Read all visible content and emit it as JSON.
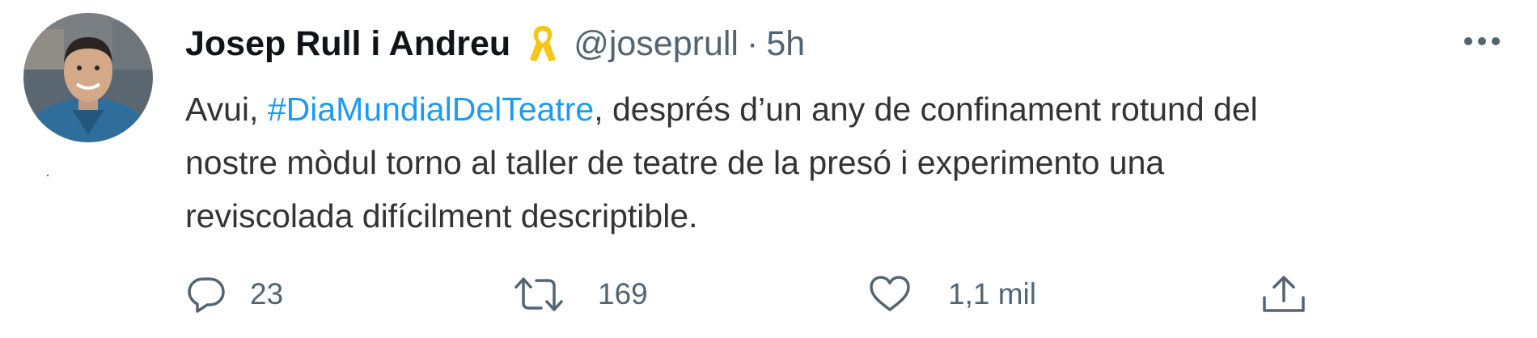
{
  "author": {
    "name": "Josep Rull i Andreu",
    "handle": "@joseprull",
    "separator": "·",
    "time": "5h",
    "badge_icon": "yellow-ribbon-icon"
  },
  "tweet": {
    "text_before": "Avui, ",
    "hashtag": "#DiaMundialDelTeatre",
    "line1_after": ", després d’un any de confinament rotund del",
    "line2": "nostre mòdul torno al taller de teatre de la presó i experimento una",
    "line3": "reviscolada difícilment descriptible."
  },
  "actions": {
    "reply": {
      "icon": "reply-icon",
      "count": "23"
    },
    "retweet": {
      "icon": "retweet-icon",
      "count": "169"
    },
    "like": {
      "icon": "heart-icon",
      "count": "1,1 mil"
    },
    "share": {
      "icon": "share-icon"
    }
  },
  "menu": {
    "icon": "more-icon"
  },
  "colors": {
    "accent": "#1d9bf0",
    "secondary_text": "#536471",
    "ribbon": "#f5c518"
  }
}
